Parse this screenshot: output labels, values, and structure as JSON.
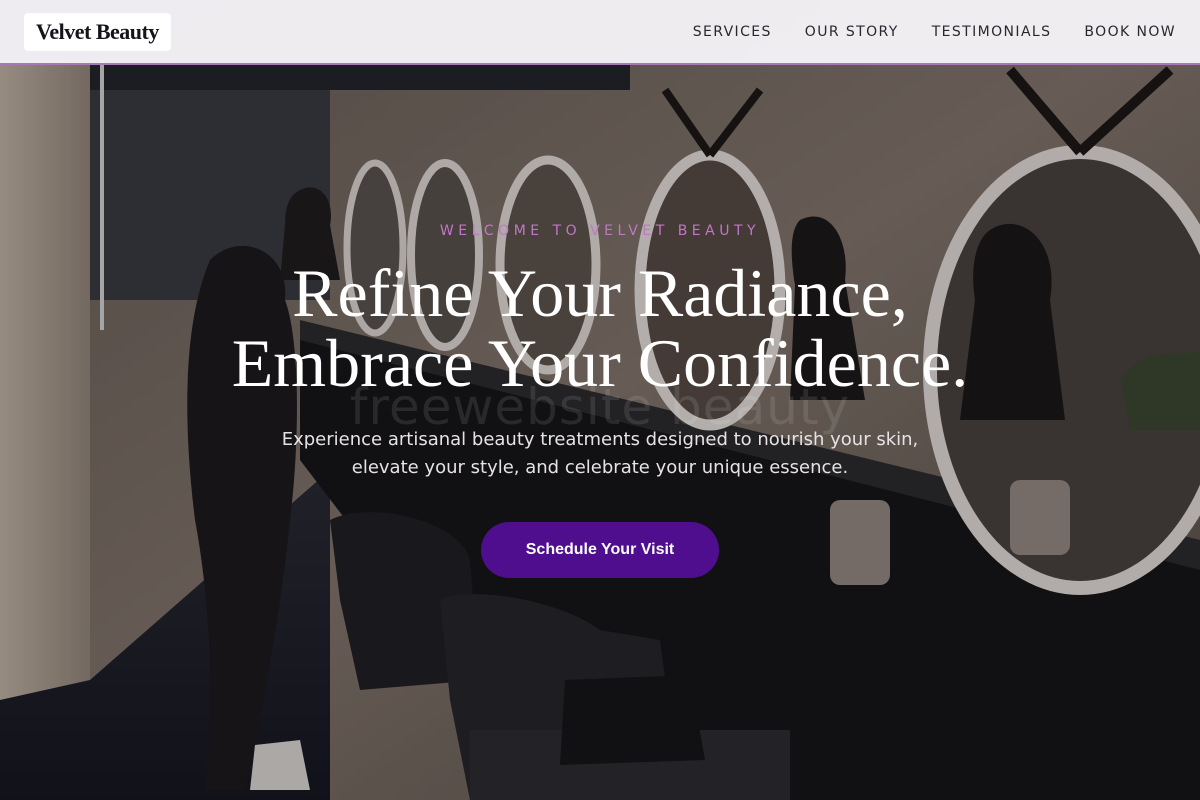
{
  "brand": {
    "name": "Velvet Beauty"
  },
  "nav": {
    "items": [
      {
        "label": "SERVICES"
      },
      {
        "label": "OUR STORY"
      },
      {
        "label": "TESTIMONIALS"
      },
      {
        "label": "BOOK NOW"
      }
    ]
  },
  "hero": {
    "eyebrow": "WELCOME TO VELVET BEAUTY",
    "headline_line1": "Refine Your Radiance,",
    "headline_line2": "Embrace Your Confidence.",
    "subtext_line1": "Experience artisanal beauty treatments designed to nourish your skin,",
    "subtext_line2": "elevate your style, and celebrate your unique essence.",
    "cta_label": "Schedule Your Visit",
    "watermark": "freewebsite beauty",
    "background_image": "salon-interior-photo"
  },
  "colors": {
    "accent_purple": "#4e0e8e",
    "eyebrow_pink": "#c176c7",
    "nav_border": "#a877b6"
  }
}
